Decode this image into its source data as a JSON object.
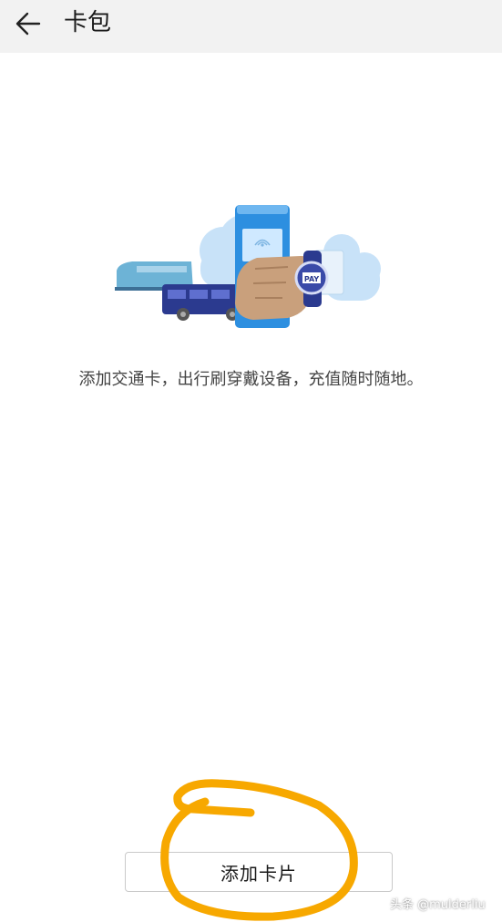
{
  "header": {
    "title": "卡包",
    "back_icon": "back-arrow-icon"
  },
  "main": {
    "illustration_badge": "PAY",
    "hint": "添加交通卡，出行刷穿戴设备，充值随时随地。"
  },
  "footer": {
    "add_card_label": "添加卡片"
  },
  "watermark": "头条 @mulderliu",
  "colors": {
    "topbar": "#f2f2f2",
    "highlight_stroke": "#f7a800",
    "pos_terminal": "#2d8fe0",
    "cloud": "#c8e2f8",
    "bus": "#2b3a8f",
    "train": "#6db3d6"
  }
}
